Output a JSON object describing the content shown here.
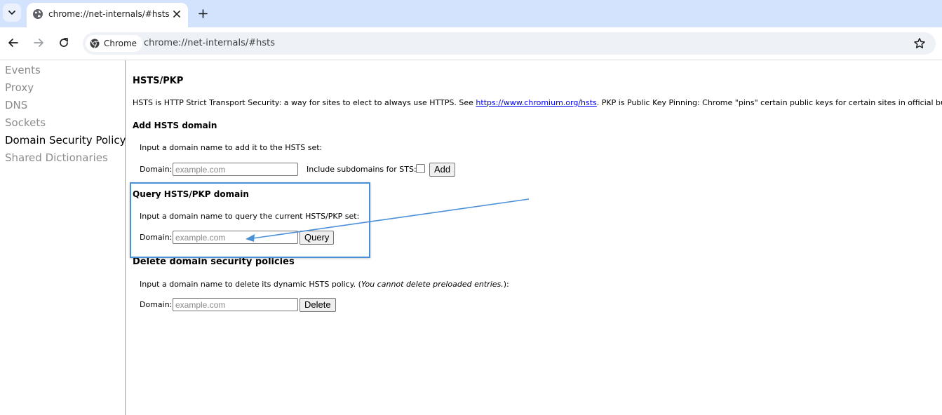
{
  "browser": {
    "tab_title": "chrome://net-internals/#hsts",
    "chip_label": "Chrome",
    "url": "chrome://net-internals/#hsts"
  },
  "sidebar": {
    "items": [
      {
        "label": "Events"
      },
      {
        "label": "Proxy"
      },
      {
        "label": "DNS"
      },
      {
        "label": "Sockets"
      },
      {
        "label": "Domain Security Policy",
        "active": true
      },
      {
        "label": "Shared Dictionaries"
      }
    ]
  },
  "hsts": {
    "title": "HSTS/PKP",
    "desc_pre": "HSTS is HTTP Strict Transport Security: a way for sites to elect to always use HTTPS. See ",
    "desc_link": "https://www.chromium.org/hsts",
    "desc_post": ". PKP is Public Key Pinning: Chrome \"pins\" certain public keys for certain sites in official builds.",
    "add": {
      "heading": "Add HSTS domain",
      "instruction": "Input a domain name to add it to the HSTS set:",
      "domain_label": "Domain:",
      "placeholder": "example.com",
      "subdomains_label": "Include subdomains for STS:",
      "button": "Add"
    },
    "query": {
      "heading": "Query HSTS/PKP domain",
      "instruction": "Input a domain name to query the current HSTS/PKP set:",
      "domain_label": "Domain:",
      "placeholder": "example.com",
      "button": "Query"
    },
    "delete": {
      "heading": "Delete domain security policies",
      "instruction_pre": "Input a domain name to delete its dynamic HSTS policy. (",
      "instruction_em": "You cannot delete preloaded entries.",
      "instruction_post": "):",
      "domain_label": "Domain:",
      "placeholder": "example.com",
      "button": "Delete"
    }
  },
  "icons": {
    "tab_search": "chevron-down-icon",
    "favicon": "globe-icon",
    "close": "close-icon",
    "new_tab": "plus-icon",
    "back": "back-arrow-icon",
    "forward": "forward-arrow-icon",
    "reload": "reload-icon",
    "chrome": "chrome-logo-icon",
    "bookmark": "star-icon"
  },
  "colors": {
    "tabstrip": "#d3e3fd",
    "omnibox": "#eef1f6",
    "link": "#0000ee",
    "annotation": "#4a90d9"
  }
}
